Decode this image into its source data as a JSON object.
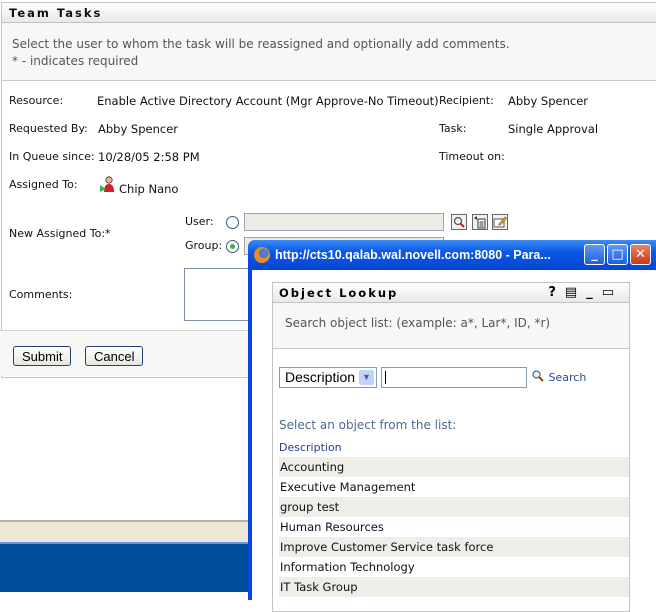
{
  "panel": {
    "title": "Team Tasks",
    "intro_line1": "Select the user to whom the task will be reassigned and optionally add comments.",
    "intro_line2": "* - indicates required"
  },
  "details": {
    "resource_label": "Resource:",
    "resource_value": "Enable Active Directory Account (Mgr Approve-No Timeout)",
    "requested_by_label": "Requested By:",
    "requested_by_value": "Abby Spencer",
    "in_queue_label": "In Queue since:",
    "in_queue_value": "10/28/05 2:58 PM",
    "assigned_to_label": "Assigned To:",
    "assigned_to_value": "Chip Nano",
    "recipient_label": "Recipient:",
    "recipient_value": "Abby Spencer",
    "task_label": "Task:",
    "task_value": "Single Approval",
    "timeout_label": "Timeout on:",
    "timeout_value": ""
  },
  "reassign": {
    "label": "New Assigned To:*",
    "user_label": "User:",
    "group_label": "Group:",
    "selected": "group",
    "user_value": "",
    "group_value": "",
    "icons": [
      "magnifier-icon",
      "history-list-icon",
      "edit-clear-icon"
    ]
  },
  "comments": {
    "label": "Comments:",
    "value": ""
  },
  "buttons": {
    "submit": "Submit",
    "cancel": "Cancel"
  },
  "popup": {
    "window_title": "http://cts10.qalab.wal.novell.com:8080 - Para...",
    "controls": {
      "minimize": "_",
      "maximize": "□",
      "close": "✕"
    },
    "panel_title": "Object Lookup",
    "header_icons": {
      "help": "?",
      "print": "▤",
      "minimize": "_",
      "maximize": "▭"
    },
    "search_hint": "Search object list: (example: a*, Lar*, ID, *r)",
    "search_field_select": "Description",
    "search_value": "",
    "search_link": "Search",
    "list_title": "Select an object from the list:",
    "column_header": "Description",
    "items": [
      "Accounting",
      "Executive Management",
      "group test",
      "Human Resources",
      "Improve Customer Service task force",
      "Information Technology",
      "IT Task Group"
    ]
  }
}
